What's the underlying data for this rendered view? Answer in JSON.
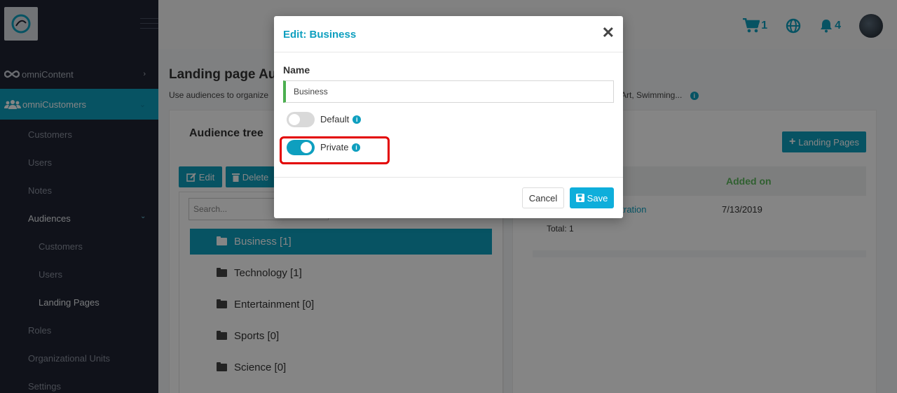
{
  "sidebar": {
    "omnicontent": "omniContent",
    "omnicustomers": "omniCustomers",
    "items": {
      "customers": "Customers",
      "users": "Users",
      "notes": "Notes",
      "audiences": "Audiences",
      "aud_customers": "Customers",
      "aud_users": "Users",
      "aud_landing": "Landing Pages",
      "roles": "Roles",
      "org_units": "Organizational Units",
      "settings": "Settings"
    }
  },
  "topbar": {
    "cart_count": "1",
    "bell_count": "4"
  },
  "page": {
    "title": "Landing page Au",
    "subtitle": "Use audiences to organize",
    "subtitle_tail": "c, Art, Swimming..."
  },
  "tree": {
    "title": "Audience tree",
    "edit_label": "Edit",
    "delete_label": "Delete",
    "search_placeholder": "Search...",
    "rows": [
      "Business [1]",
      "Technology [1]",
      "Entertainment [0]",
      "Sports [0]",
      "Science [0]"
    ]
  },
  "right_panel": {
    "add_button": "Landing Pages",
    "col_added_on": "Added on",
    "row_link": "istration",
    "row_date": "7/13/2019",
    "total": "Total: 1"
  },
  "modal": {
    "title": "Edit: Business",
    "name_label": "Name",
    "name_value": "Business",
    "default_label": "Default",
    "default_on": false,
    "private_label": "Private",
    "private_on": true,
    "cancel_label": "Cancel",
    "save_label": "Save"
  },
  "colors": {
    "accent": "#0e9fbf",
    "sidebar_bg": "#1f2333",
    "highlight": "#e30000",
    "valid_border": "#4caf50"
  }
}
